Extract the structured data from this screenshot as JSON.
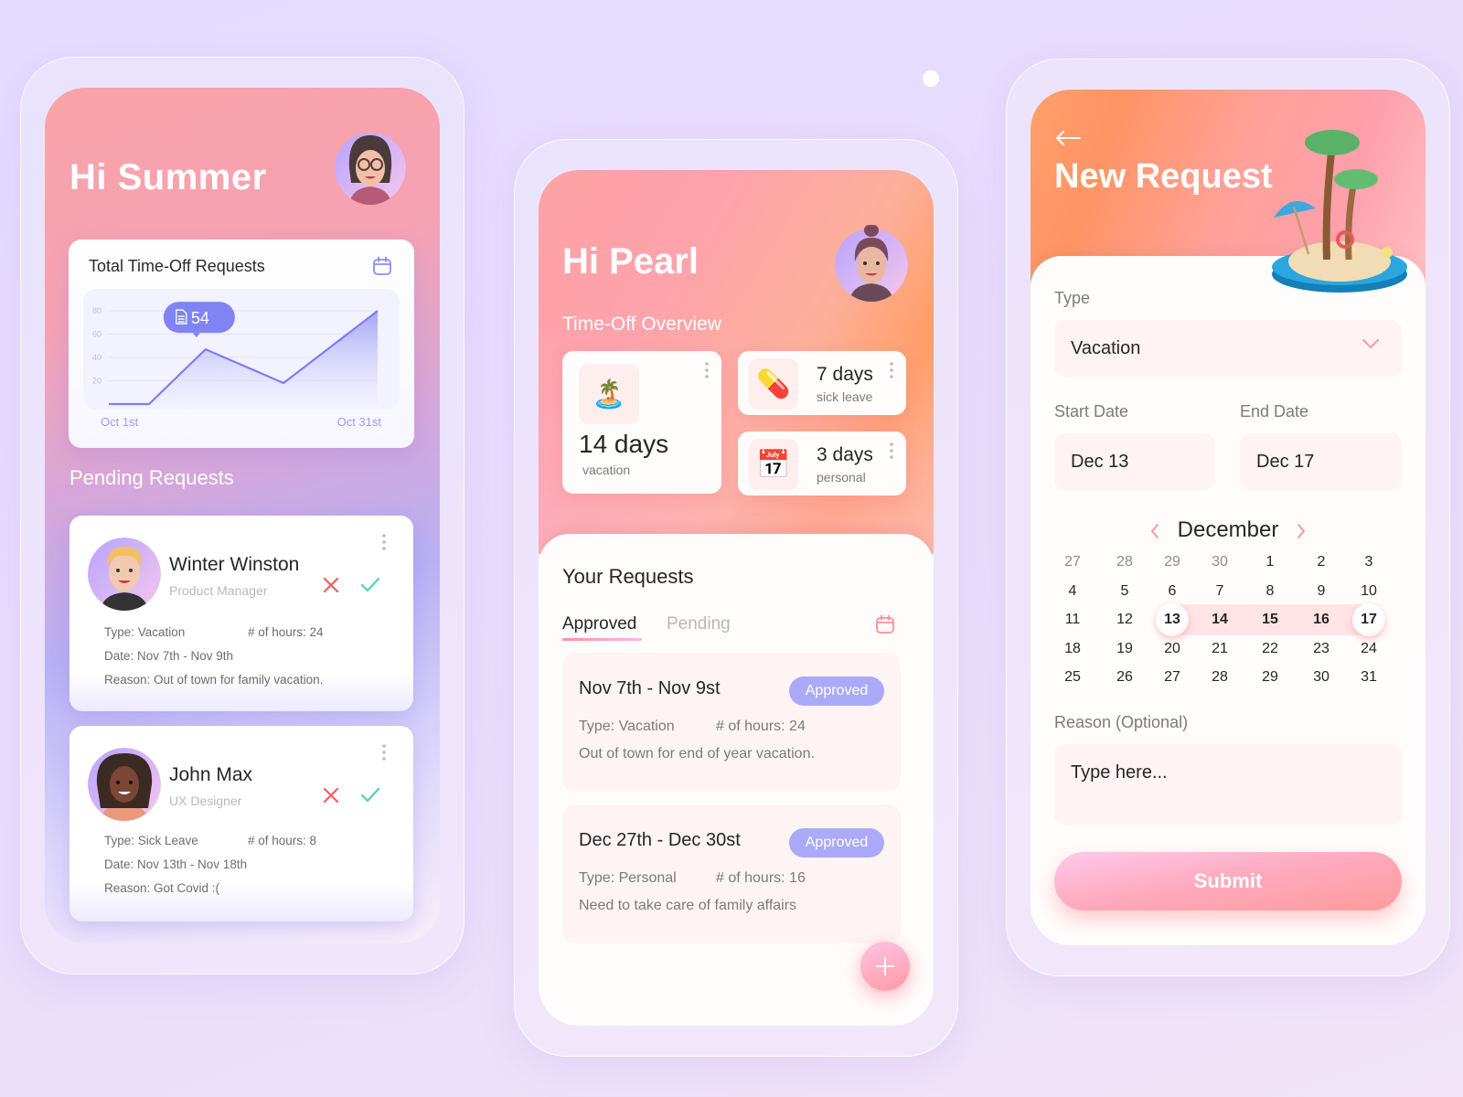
{
  "phone1": {
    "greeting": "Hi Summer",
    "chart_title": "Total Time-Off Requests",
    "tooltip_value": "54",
    "pending_title": "Pending Requests",
    "requests": [
      {
        "name": "Winter Winston",
        "role": "Product Manager",
        "type": "Type: Vacation",
        "hours": "# of hours: 24",
        "date": "Date: Nov 7th - Nov 9th",
        "reason": "Reason: Out of town for family vacation."
      },
      {
        "name": "John Max",
        "role": "UX Designer",
        "type": "Type: Sick Leave",
        "hours": "# of hours: 8",
        "date": "Date: Nov 13th - Nov 18th",
        "reason": "Reason: Got Covid :("
      }
    ]
  },
  "chart_data": {
    "type": "area",
    "title": "Total Time-Off Requests",
    "xlabel": "",
    "ylabel": "",
    "x_tick_labels": [
      "Oct 1st",
      "Oct 31st"
    ],
    "y_ticks": [
      20,
      40,
      60,
      80
    ],
    "ylim": [
      0,
      80
    ],
    "grid": true,
    "points": [
      {
        "x": 0,
        "y": 0
      },
      {
        "x": 0.15,
        "y": 0
      },
      {
        "x": 0.36,
        "y": 47
      },
      {
        "x": 0.65,
        "y": 18
      },
      {
        "x": 1.0,
        "y": 80
      }
    ],
    "annotation": {
      "label": "54",
      "icon": "document-icon"
    },
    "colors": {
      "line": "#7b7ef5",
      "fill_top": "#9b9cf7",
      "fill_bottom": "#ecebfe"
    }
  },
  "phone2": {
    "greeting": "Hi Pearl",
    "overview_title": "Time-Off Overview",
    "stats": [
      {
        "value": "14 days",
        "label": "vacation",
        "icon": "🏝️"
      },
      {
        "value": "7 days",
        "label": "sick leave",
        "icon": "💊"
      },
      {
        "value": "3 days",
        "label": "personal",
        "icon": "📅"
      }
    ],
    "your_requests_title": "Your Requests",
    "tabs": [
      "Approved",
      "Pending"
    ],
    "requests": [
      {
        "dates": "Nov 7th - Nov 9st",
        "status": "Approved",
        "type": "Type: Vacation",
        "hours": "# of hours: 24",
        "reason": "Out of town for end of year vacation."
      },
      {
        "dates": "Dec 27th - Dec 30st",
        "status": "Approved",
        "type": "Type: Personal",
        "hours": "# of hours: 16",
        "reason": "Need to take care of family affairs"
      }
    ],
    "fab_icon": "plus-icon"
  },
  "phone3": {
    "title": "New Request",
    "type_label": "Type",
    "type_value": "Vacation",
    "start_label": "Start Date",
    "start_value": "Dec 13",
    "end_label": "End Date",
    "end_value": "Dec 17",
    "month": "December",
    "calendar": [
      [
        {
          "d": "27",
          "out": true
        },
        {
          "d": "28",
          "out": true
        },
        {
          "d": "29",
          "out": true
        },
        {
          "d": "30",
          "out": true
        },
        {
          "d": "1"
        },
        {
          "d": "2"
        },
        {
          "d": "3"
        }
      ],
      [
        {
          "d": "4"
        },
        {
          "d": "5"
        },
        {
          "d": "6"
        },
        {
          "d": "7"
        },
        {
          "d": "8"
        },
        {
          "d": "9"
        },
        {
          "d": "10"
        }
      ],
      [
        {
          "d": "11"
        },
        {
          "d": "12"
        },
        {
          "d": "13",
          "sel": "start"
        },
        {
          "d": "14",
          "in": true
        },
        {
          "d": "15",
          "in": true
        },
        {
          "d": "16",
          "in": true
        },
        {
          "d": "17",
          "sel": "end"
        }
      ],
      [
        {
          "d": "18"
        },
        {
          "d": "19"
        },
        {
          "d": "20"
        },
        {
          "d": "21"
        },
        {
          "d": "22"
        },
        {
          "d": "23"
        },
        {
          "d": "24"
        }
      ],
      [
        {
          "d": "25"
        },
        {
          "d": "26"
        },
        {
          "d": "27"
        },
        {
          "d": "28"
        },
        {
          "d": "29"
        },
        {
          "d": "30"
        },
        {
          "d": "31"
        }
      ]
    ],
    "reason_label": "Reason (Optional)",
    "reason_placeholder": "Type here...",
    "submit_label": "Submit"
  },
  "colors": {
    "accent_purple": "#7b7ef5",
    "badge": "#aaaaf8",
    "reject": "#f25c5c",
    "approve": "#4fd1b0",
    "coral": "#ff9b9b"
  }
}
